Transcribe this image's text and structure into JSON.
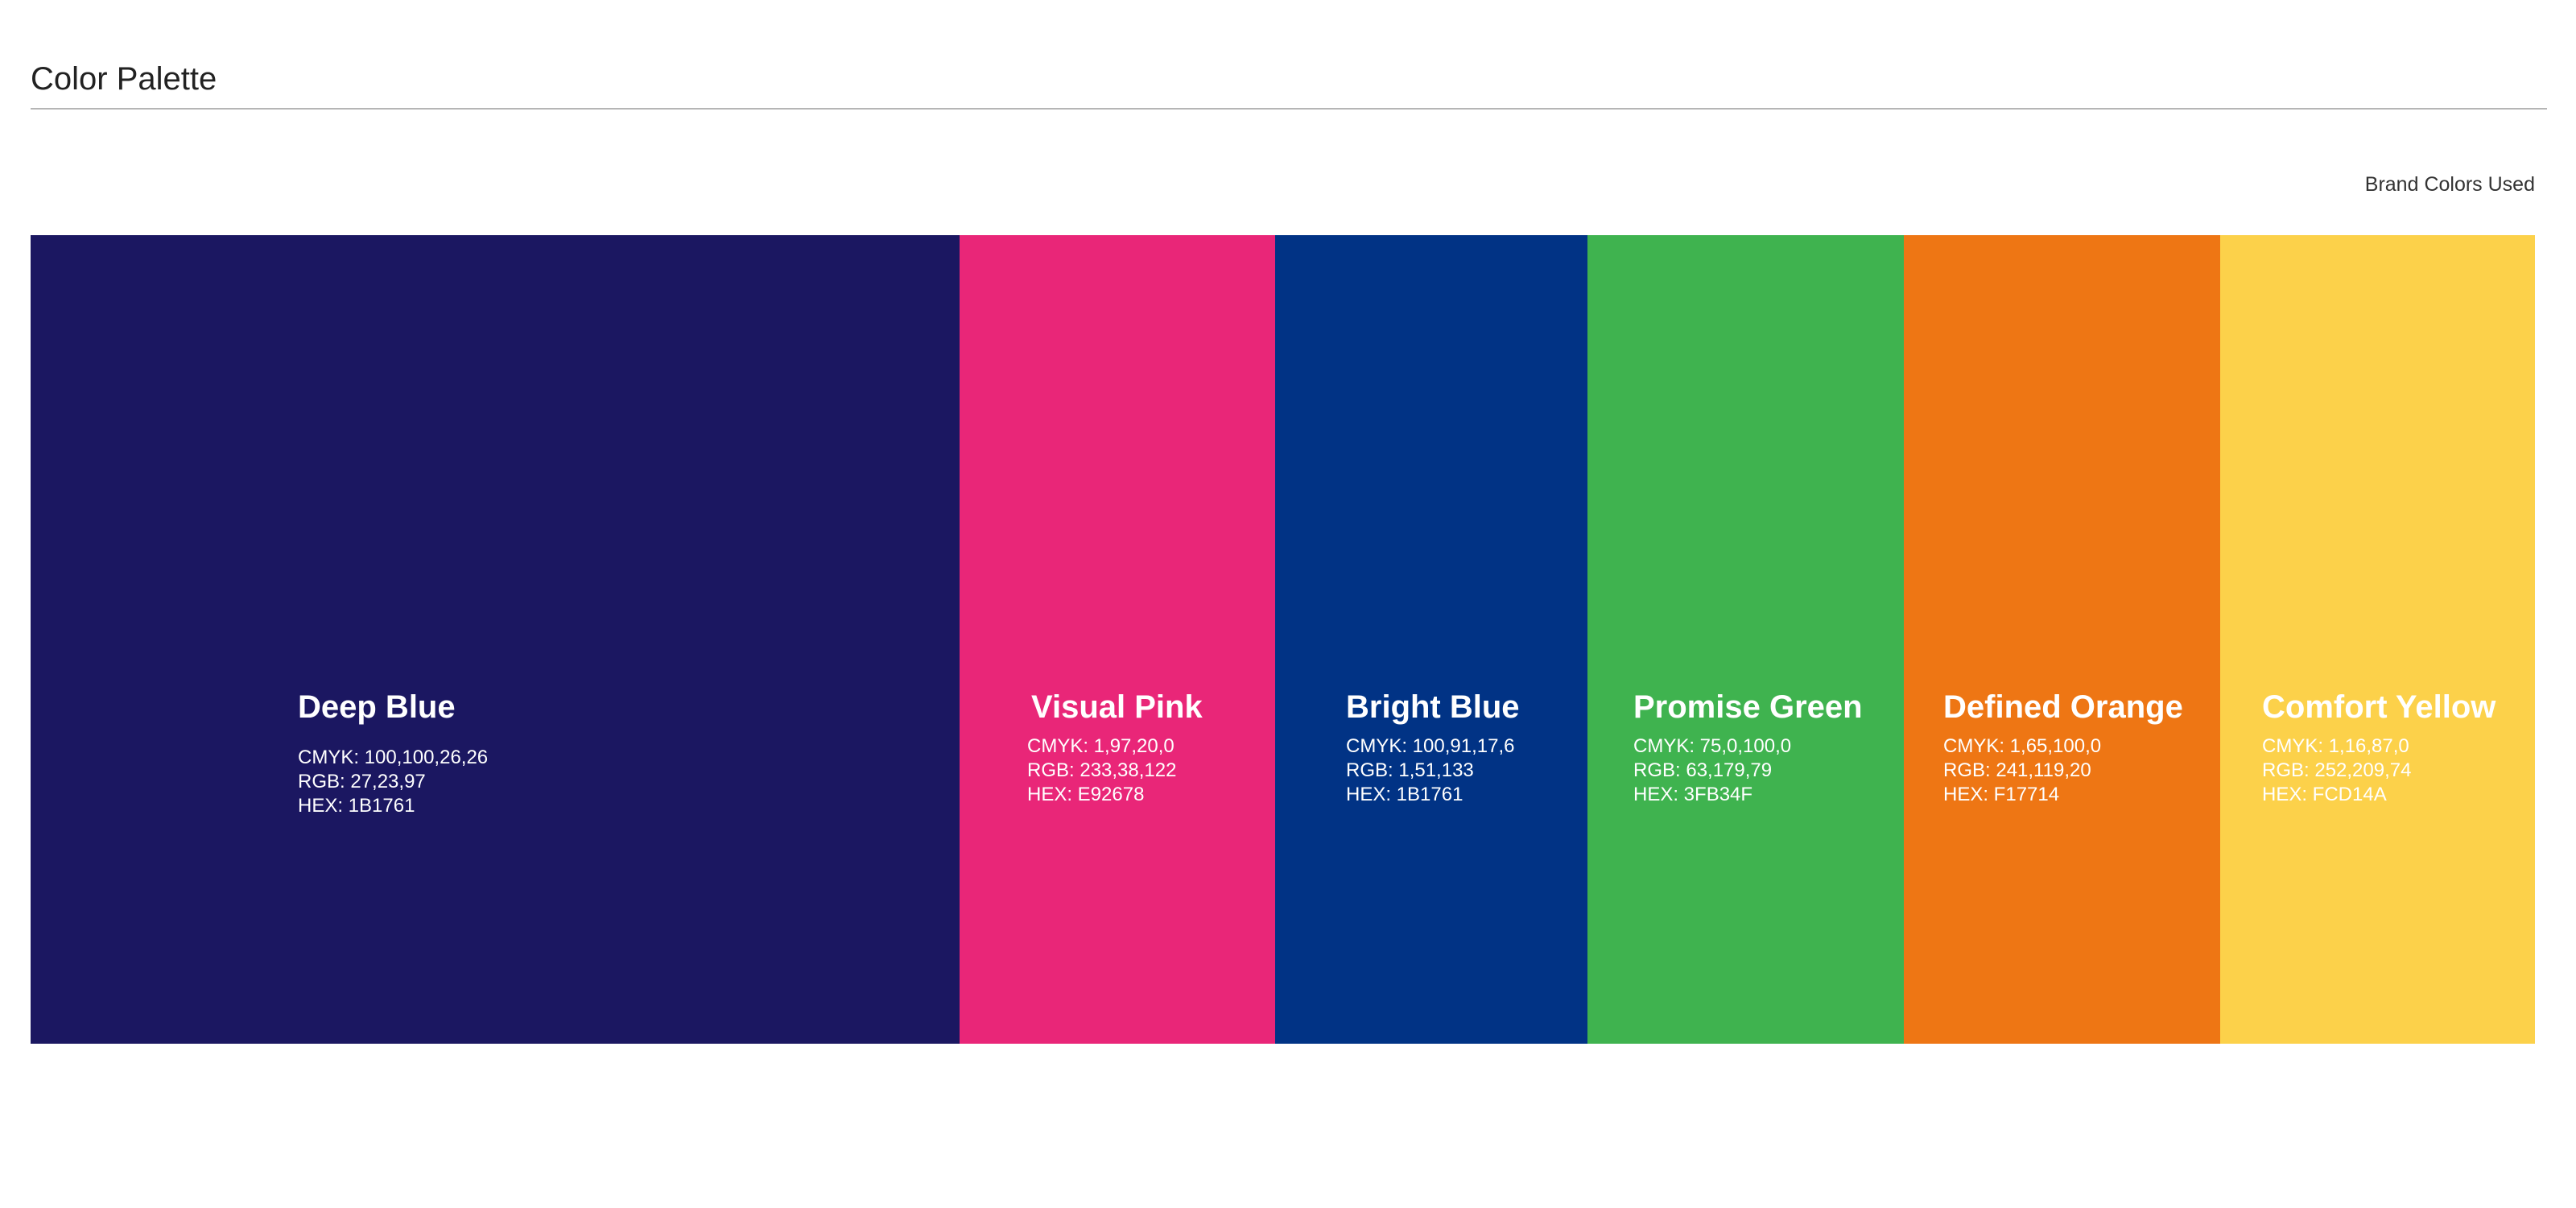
{
  "header": {
    "title": "Color Palette",
    "subtitle": "Brand Colors Used"
  },
  "swatches": [
    {
      "name": "Deep Blue",
      "cmyk": "CMYK: 100,100,26,26",
      "rgb": "RGB: 27,23,97",
      "hex": "HEX: 1B1761",
      "fill": "#1B1761"
    },
    {
      "name": "Visual Pink",
      "cmyk": "CMYK: 1,97,20,0",
      "rgb": "RGB: 233,38,122",
      "hex": "HEX: E92678",
      "fill": "#E92678"
    },
    {
      "name": "Bright Blue",
      "cmyk": "CMYK: 100,91,17,6",
      "rgb": "RGB: 1,51,133",
      "hex": "HEX: 1B1761",
      "fill": "#013385"
    },
    {
      "name": "Promise Green",
      "cmyk": "CMYK: 75,0,100,0",
      "rgb": "RGB: 63,179,79",
      "hex": "HEX: 3FB34F",
      "fill": "#3FB34F"
    },
    {
      "name": "Defined Orange",
      "cmyk": "CMYK: 1,65,100,0",
      "rgb": "RGB: 241,119,20",
      "hex": "HEX: F17714",
      "fill": "#EE7614"
    },
    {
      "name": "Comfort Yellow",
      "cmyk": "CMYK: 1,16,87,0",
      "rgb": "RGB: 252,209,74",
      "hex": "HEX: FCD14A",
      "fill": "#FCD14A"
    }
  ]
}
